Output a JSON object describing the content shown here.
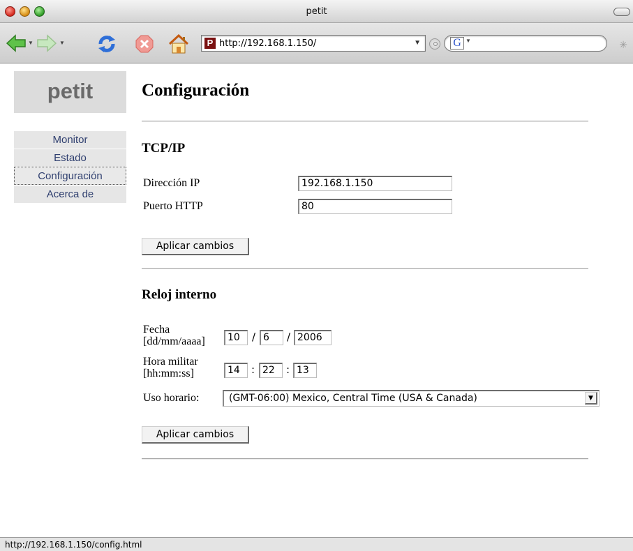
{
  "window": {
    "title": "petit"
  },
  "toolbar": {
    "url": "http://192.168.1.150/",
    "favicon_letter": "P",
    "search_engine_letter": "G",
    "search_placeholder": "",
    "icons": [
      "back-arrow-icon",
      "forward-arrow-icon",
      "reload-icon",
      "stop-icon",
      "home-icon",
      "go-icon",
      "google-icon",
      "spinner-icon"
    ]
  },
  "sidebar": {
    "brand": "petit",
    "items": [
      {
        "label": "Monitor"
      },
      {
        "label": "Estado"
      },
      {
        "label": "Configuración",
        "active": true
      },
      {
        "label": "Acerca de"
      }
    ]
  },
  "main": {
    "title": "Configuración",
    "tcpip": {
      "heading": "TCP/IP",
      "ip_label": "Dirección IP",
      "ip_value": "192.168.1.150",
      "port_label": "Puerto HTTP",
      "port_value": "80",
      "apply_label": "Aplicar cambios"
    },
    "clock": {
      "heading": "Reloj interno",
      "date_label_1": "Fecha",
      "date_label_2": "[dd/mm/aaaa]",
      "day": "10",
      "month": "6",
      "year": "2006",
      "date_sep": "/",
      "time_label_1": "Hora militar",
      "time_label_2": "[hh:mm:ss]",
      "hour": "14",
      "minute": "22",
      "second": "13",
      "time_sep": ":",
      "tz_label": "Uso horario:",
      "tz_value": "(GMT-06:00) Mexico, Central Time (USA & Canada)",
      "apply_label": "Aplicar cambios"
    }
  },
  "statusbar": {
    "text": "http://192.168.1.150/config.html"
  },
  "colors": {
    "nav_text": "#2f3f6f",
    "sidebar_bg": "#e6e6e6",
    "brand_bg": "#dcdcdc"
  }
}
